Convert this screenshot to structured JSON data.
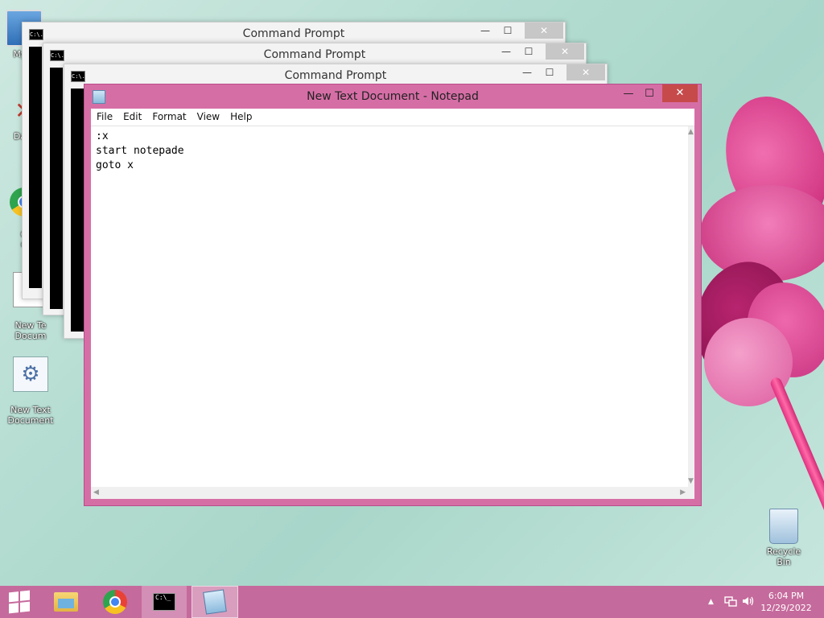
{
  "desktop": {
    "icons": [
      {
        "label": "My C"
      },
      {
        "label": "Data"
      },
      {
        "label": "G\nC"
      },
      {
        "label": "New Te\nDocum"
      },
      {
        "label": "New Text\nDocument"
      },
      {
        "label": "Recycle Bin"
      }
    ]
  },
  "cmd_windows": [
    {
      "title": "Command Prompt",
      "icon_text": "C:\\."
    },
    {
      "title": "Command Prompt",
      "icon_text": "C:\\."
    },
    {
      "title": "Command Prompt",
      "icon_text": "C:\\."
    }
  ],
  "notepad": {
    "title": "New Text Document - Notepad",
    "menu": [
      "File",
      "Edit",
      "Format",
      "View",
      "Help"
    ],
    "content": ":x\nstart notepade\ngoto x",
    "controls": {
      "minimize": "—",
      "maximize": "☐",
      "close": "✕"
    }
  },
  "taskbar": {
    "tray": {
      "up_arrow": "▲",
      "network_icon": "network-icon",
      "volume_icon": "volume-icon",
      "time": "6:04 PM",
      "date": "12/29/2022"
    }
  },
  "colors": {
    "window_accent": "#d66ea6",
    "taskbar": "#c56a9c",
    "close_button": "#c74a4a"
  }
}
